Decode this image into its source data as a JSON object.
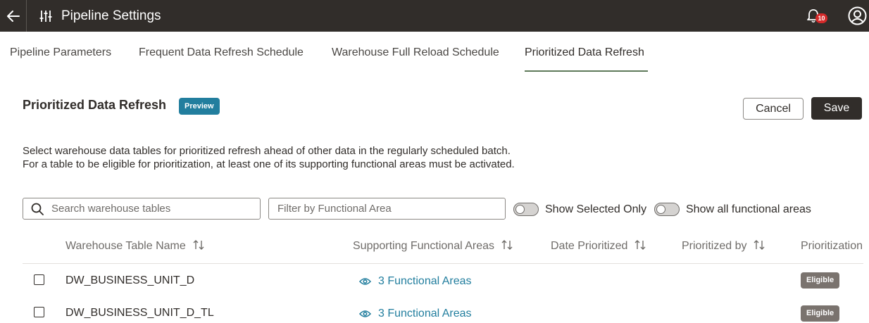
{
  "header": {
    "title": "Pipeline Settings",
    "notification_count": "10",
    "icons": {
      "back": "arrow-left-icon",
      "settings": "sliders-icon",
      "bell": "bell-icon",
      "profile": "user-avatar-icon"
    }
  },
  "tabs": [
    {
      "label": "Pipeline Parameters",
      "active": false
    },
    {
      "label": "Frequent Data Refresh Schedule",
      "active": false
    },
    {
      "label": "Warehouse Full Reload Schedule",
      "active": false
    },
    {
      "label": "Prioritized Data Refresh",
      "active": true
    }
  ],
  "section": {
    "title": "Prioritized Data Refresh",
    "badge": "Preview",
    "cancel_label": "Cancel",
    "save_label": "Save",
    "description_line1": "Select warehouse data tables for prioritized refresh ahead of other data in the regularly scheduled batch.",
    "description_line2": "For a table to be eligible for prioritization, at least one of its supporting functional areas must be activated."
  },
  "filters": {
    "search_placeholder": "Search warehouse tables",
    "filter_placeholder": "Filter by Functional Area",
    "toggle_selected_label": "Show Selected Only",
    "toggle_selected_on": false,
    "toggle_all_label": "Show all functional areas",
    "toggle_all_on": false
  },
  "table": {
    "columns": [
      "Warehouse Table Name",
      "Supporting Functional Areas",
      "Date Prioritized",
      "Prioritized by",
      "Prioritization"
    ],
    "rows": [
      {
        "name": "DW_BUSINESS_UNIT_D",
        "functional_areas": "3 Functional Areas",
        "date": "",
        "by": "",
        "status": "Eligible",
        "checked": false
      },
      {
        "name": "DW_BUSINESS_UNIT_D_TL",
        "functional_areas": "3 Functional Areas",
        "date": "",
        "by": "",
        "status": "Eligible",
        "checked": false
      }
    ]
  },
  "colors": {
    "header_bg": "#312d2a",
    "accent_teal": "#227e9e",
    "tab_underline": "#5e7a5a",
    "badge_red": "#d42a2a",
    "eligible_bg": "#7a736e"
  }
}
